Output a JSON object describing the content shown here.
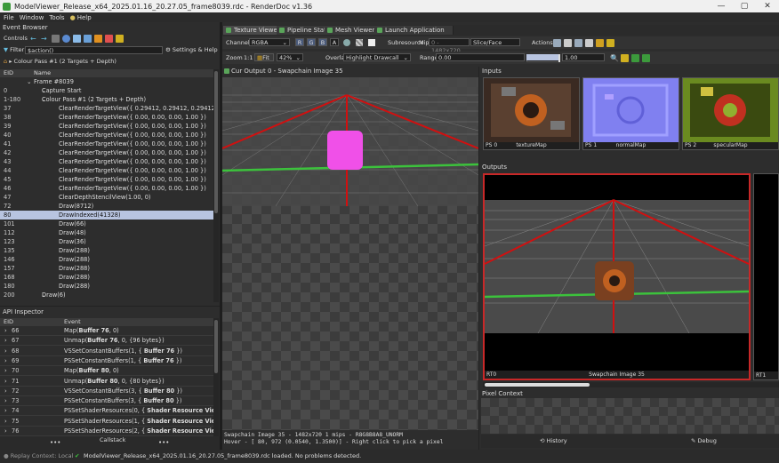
{
  "window": {
    "title": "ModelViewer_Release_x64_2025.01.16_20.27.05_frame8039.rdc - RenderDoc v1.36",
    "minimize": "—",
    "maximize": "▢",
    "close": "✕"
  },
  "menu": [
    "File",
    "Window",
    "Tools",
    "Help"
  ],
  "event_browser": {
    "title": "Event Browser",
    "controls_label": "Controls",
    "filter_label": "Filter",
    "filter_value": "$action()",
    "settings_label": "Settings & Help",
    "breadcrumb": "Colour Pass #1 (2 Targets + Depth)",
    "col_eid": "EID",
    "col_name": "Name",
    "rows": [
      {
        "eid": "",
        "name": "Frame #8039",
        "indent": 0,
        "selected": false
      },
      {
        "eid": "0",
        "name": "Capture Start",
        "indent": 1,
        "selected": false
      },
      {
        "eid": "1-180",
        "name": "Colour Pass #1 (2 Targets + Depth)",
        "indent": 1,
        "selected": false
      },
      {
        "eid": "37",
        "name": "ClearRenderTargetView({ 0.29412, 0.29412, 0.29412, 1.00 })",
        "indent": 2,
        "selected": false
      },
      {
        "eid": "38",
        "name": "ClearRenderTargetView({ 0.00, 0.00, 0.00, 1.00 })",
        "indent": 2,
        "selected": false
      },
      {
        "eid": "39",
        "name": "ClearRenderTargetView({ 0.00, 0.00, 0.00, 1.00 })",
        "indent": 2,
        "selected": false
      },
      {
        "eid": "40",
        "name": "ClearRenderTargetView({ 0.00, 0.00, 0.00, 1.00 })",
        "indent": 2,
        "selected": false
      },
      {
        "eid": "41",
        "name": "ClearRenderTargetView({ 0.00, 0.00, 0.00, 1.00 })",
        "indent": 2,
        "selected": false
      },
      {
        "eid": "42",
        "name": "ClearRenderTargetView({ 0.00, 0.00, 0.00, 1.00 })",
        "indent": 2,
        "selected": false
      },
      {
        "eid": "43",
        "name": "ClearRenderTargetView({ 0.00, 0.00, 0.00, 1.00 })",
        "indent": 2,
        "selected": false
      },
      {
        "eid": "44",
        "name": "ClearRenderTargetView({ 0.00, 0.00, 0.00, 1.00 })",
        "indent": 2,
        "selected": false
      },
      {
        "eid": "45",
        "name": "ClearRenderTargetView({ 0.00, 0.00, 0.00, 1.00 })",
        "indent": 2,
        "selected": false
      },
      {
        "eid": "46",
        "name": "ClearRenderTargetView({ 0.00, 0.00, 0.00, 1.00 })",
        "indent": 2,
        "selected": false
      },
      {
        "eid": "47",
        "name": "ClearDepthStencilView(1.00, 0)",
        "indent": 2,
        "selected": false
      },
      {
        "eid": "72",
        "name": "Draw(8712)",
        "indent": 2,
        "selected": false
      },
      {
        "eid": "80",
        "name": "DrawIndexed(41328)",
        "indent": 2,
        "selected": true
      },
      {
        "eid": "101",
        "name": "Draw(66)",
        "indent": 2,
        "selected": false
      },
      {
        "eid": "112",
        "name": "Draw(48)",
        "indent": 2,
        "selected": false
      },
      {
        "eid": "123",
        "name": "Draw(36)",
        "indent": 2,
        "selected": false
      },
      {
        "eid": "135",
        "name": "Draw(288)",
        "indent": 2,
        "selected": false
      },
      {
        "eid": "146",
        "name": "Draw(288)",
        "indent": 2,
        "selected": false
      },
      {
        "eid": "157",
        "name": "Draw(288)",
        "indent": 2,
        "selected": false
      },
      {
        "eid": "168",
        "name": "Draw(288)",
        "indent": 2,
        "selected": false
      },
      {
        "eid": "180",
        "name": "Draw(288)",
        "indent": 2,
        "selected": false
      },
      {
        "eid": "200",
        "name": "Draw(6)",
        "indent": 1,
        "selected": false
      }
    ]
  },
  "api_inspector": {
    "title": "API Inspector",
    "col_eid": "EID",
    "col_event": "Event",
    "rows": [
      {
        "eid": "66",
        "pre": "Map(",
        "bold": "Buffer 76",
        "post": ", 0)"
      },
      {
        "eid": "67",
        "pre": "Unmap(",
        "bold": "Buffer 76",
        "post": ", 0, {96 bytes})"
      },
      {
        "eid": "68",
        "pre": "VSSetConstantBuffers(1, { ",
        "bold": "Buffer 76",
        "post": " })"
      },
      {
        "eid": "69",
        "pre": "PSSetConstantBuffers(1, { ",
        "bold": "Buffer 76",
        "post": " })"
      },
      {
        "eid": "70",
        "pre": "Map(",
        "bold": "Buffer 80",
        "post": ", 0)"
      },
      {
        "eid": "71",
        "pre": "Unmap(",
        "bold": "Buffer 80",
        "post": ", 0, {80 bytes})"
      },
      {
        "eid": "72",
        "pre": "VSSetConstantBuffers(3, { ",
        "bold": "Buffer 80",
        "post": " })"
      },
      {
        "eid": "73",
        "pre": "PSSetConstantBuffers(3, { ",
        "bold": "Buffer 80",
        "post": " })"
      },
      {
        "eid": "74",
        "pre": "PSSetShaderResources(0, { ",
        "bold": "Shader Resource View 215",
        "post": ""
      },
      {
        "eid": "75",
        "pre": "PSSetShaderResources(1, { ",
        "bold": "Shader Resource View 217",
        "post": ""
      },
      {
        "eid": "76",
        "pre": "PSSetShaderResources(2, { ",
        "bold": "Shader Resource View 219",
        "post": ""
      }
    ],
    "callstack_label": "Callstack",
    "dots": "•••"
  },
  "tabs": [
    "Texture Viewer",
    "Pipeline State",
    "Mesh Viewer",
    "Launch Application"
  ],
  "texture_viewer": {
    "channels_label": "Channels",
    "channels_value": "RGBA",
    "channel_buttons": [
      "R",
      "G",
      "B",
      "A"
    ],
    "subresource_label": "Subresource",
    "mip_label": "Mip",
    "mip_value": "0 - 1482x720",
    "slice_label": "Slice/Face",
    "actions_label": "Actions",
    "zoom_label": "Zoom",
    "zoom_1to1": "1:1",
    "fit_label": "Fit",
    "zoom_value": "42%",
    "overlay_label": "Overlay",
    "overlay_value": "Highlight Drawcall",
    "range_label": "Range",
    "range_min": "0.00",
    "range_max": "1.00",
    "image_tab": "Cur Output 0 - Swapchain Image 35",
    "inputs_label": "Inputs",
    "outputs_label": "Outputs",
    "inputs": [
      {
        "slot": "PS 0",
        "name": "textureMap"
      },
      {
        "slot": "PS 1",
        "name": "normalMap"
      },
      {
        "slot": "PS 2",
        "name": "specularMap"
      }
    ],
    "outputs": [
      {
        "slot": "RT0",
        "name": "Swapchain Image 35"
      },
      {
        "slot": "RT1",
        "name": ""
      }
    ],
    "pixel_context_label": "Pixel Context",
    "history_label": "History",
    "debug_label": "Debug",
    "status_line1": "Swapchain Image 35 - 1482x720 1 mips - R8G8B8A8_UNORM",
    "status_line2": "Hover - [  80,  972 (0.0540, 1.3500)] - Right click to pick a pixel"
  },
  "statusbar": {
    "replay_context": "Replay Context: Local",
    "message": "ModelViewer_Release_x64_2025.01.16_20.27.05_frame8039.rdc loaded. No problems detected."
  },
  "colors": {
    "accent": "#b8c4e0",
    "green": "#3cc23c",
    "red": "#d01010",
    "magenta": "#f050e8",
    "outline_red": "#c82828"
  }
}
